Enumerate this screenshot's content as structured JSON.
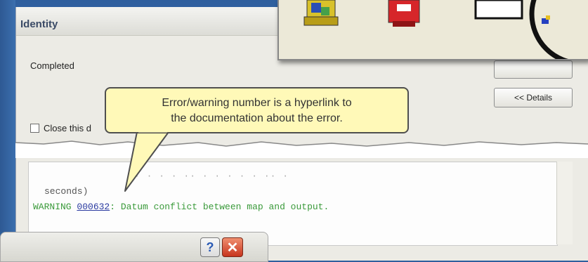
{
  "dialog": {
    "title": "Identity",
    "status": "Completed",
    "close_checkbox_label": "Close this d",
    "details_button": "<< Details"
  },
  "callout": {
    "line1": "Error/warning number is a hyperlink to",
    "line2": "the documentation about the error."
  },
  "log": {
    "line1": "seconds)",
    "warning_prefix": "WARNING",
    "warning_code": "000632",
    "warning_text": ": Datum conflict between map and output."
  },
  "mini_dialog": {
    "help_symbol": "?",
    "close_symbol": "✕"
  },
  "toolbar": {
    "icons": [
      "toolbox-icon",
      "red-toolbox-icon",
      "blank-window-icon",
      "model-icon"
    ]
  }
}
